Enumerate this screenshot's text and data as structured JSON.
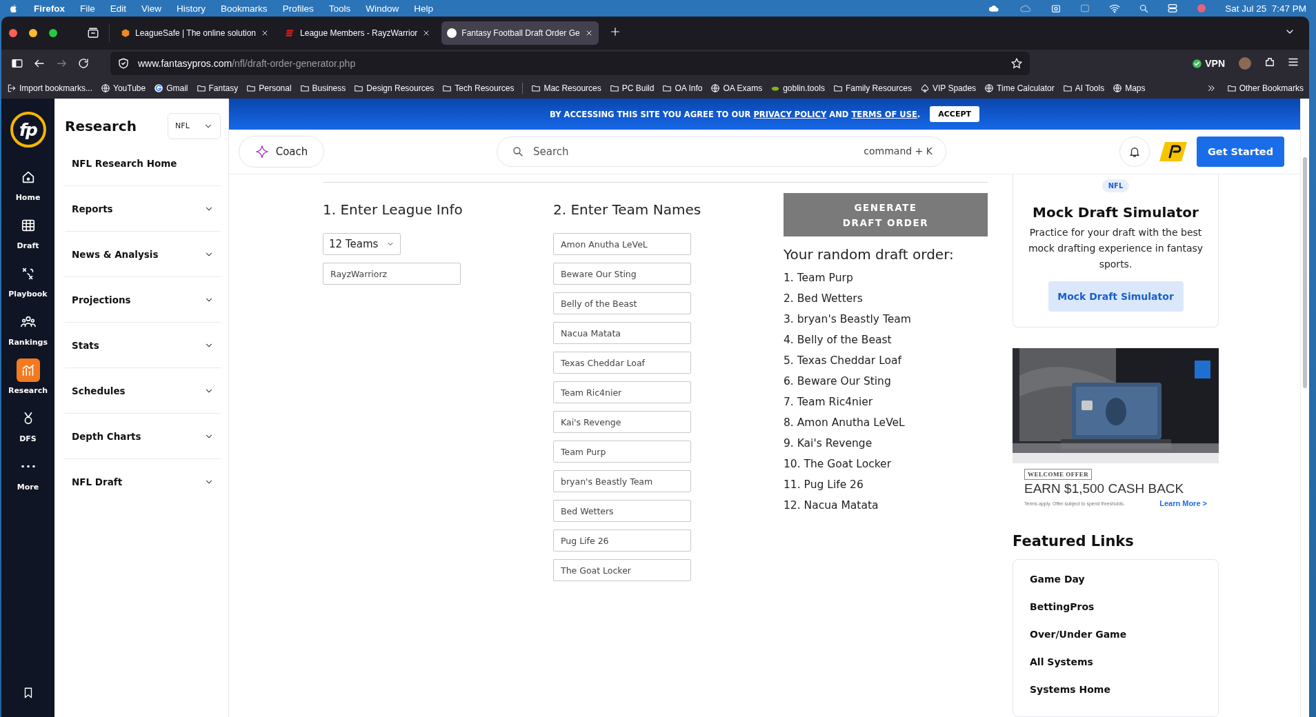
{
  "menu_bar": {
    "app": "Firefox",
    "menus": [
      "File",
      "Edit",
      "View",
      "History",
      "Bookmarks",
      "Profiles",
      "Tools",
      "Window",
      "Help"
    ],
    "clock": "Sat Jul 25  7:47 PM"
  },
  "tabs": [
    {
      "title": "LeagueSafe | The online solution",
      "kind": "hexagon",
      "selected": false
    },
    {
      "title": "League Members - RayzWarrior",
      "kind": "stripes",
      "selected": false
    },
    {
      "title": "Fantasy Football Draft Order Ge",
      "kind": "badge",
      "selected": true
    }
  ],
  "address": {
    "domain": "www.fantasypros.com",
    "path": "/nfl/draft-order-generator.php"
  },
  "vpn": "VPN",
  "bookmarks": [
    {
      "label": "Import bookmarks...",
      "kind": "import"
    },
    {
      "label": "YouTube",
      "kind": "globe"
    },
    {
      "label": "Gmail",
      "kind": "google"
    },
    {
      "label": "Fantasy",
      "kind": "folder"
    },
    {
      "label": "Personal",
      "kind": "folder"
    },
    {
      "label": "Business",
      "kind": "folder"
    },
    {
      "label": "Design Resources",
      "kind": "folder"
    },
    {
      "label": "Tech Resources",
      "kind": "folder"
    },
    {
      "label": "Mac Resources",
      "kind": "folder"
    },
    {
      "label": "PC Build",
      "kind": "folder"
    },
    {
      "label": "OA Info",
      "kind": "folder"
    },
    {
      "label": "OA Exams",
      "kind": "globe"
    },
    {
      "label": "goblin.tools",
      "kind": "goblin"
    },
    {
      "label": "Family Resources",
      "kind": "folder"
    },
    {
      "label": "VIP Spades",
      "kind": "spade"
    },
    {
      "label": "Time Calculator",
      "kind": "globe"
    },
    {
      "label": "AI Tools",
      "kind": "folder"
    },
    {
      "label": "Maps",
      "kind": "globe"
    }
  ],
  "other_bookmarks": "Other Bookmarks",
  "logo": "fp",
  "rail": [
    {
      "label": "Home",
      "kind": "home",
      "selected": false
    },
    {
      "label": "Draft",
      "kind": "grid",
      "selected": false
    },
    {
      "label": "Playbook",
      "kind": "plays",
      "selected": false
    },
    {
      "label": "Rankings",
      "kind": "people",
      "selected": false
    },
    {
      "label": "Research",
      "kind": "chart",
      "selected": true
    },
    {
      "label": "DFS",
      "kind": "medal",
      "selected": false
    },
    {
      "label": "More",
      "kind": "dots",
      "selected": false
    }
  ],
  "sidebar": {
    "title": "Research",
    "sport": "NFL",
    "items": [
      {
        "label": "NFL Research Home",
        "kind": "link"
      },
      {
        "label": "Reports",
        "kind": "group"
      },
      {
        "label": "News & Analysis",
        "kind": "group"
      },
      {
        "label": "Projections",
        "kind": "group"
      },
      {
        "label": "Stats",
        "kind": "group"
      },
      {
        "label": "Schedules",
        "kind": "group"
      },
      {
        "label": "Depth Charts",
        "kind": "group"
      },
      {
        "label": "NFL Draft",
        "kind": "group"
      }
    ]
  },
  "banner": {
    "segments": [
      {
        "text": "BY ACCESSING THIS SITE YOU AGREE TO OUR",
        "kind": "text"
      },
      {
        "text": "PRIVACY POLICY",
        "kind": "link"
      },
      {
        "text": "AND",
        "kind": "text"
      },
      {
        "text": "TERMS OF USE",
        "kind": "link"
      }
    ],
    "end": ".",
    "button": "ACCEPT"
  },
  "header": {
    "coach": "Coach",
    "search": {
      "placeholder": "Search"
    },
    "shortcut": "command + K",
    "cta": "Get Started"
  },
  "league": {
    "heading": "1. Enter League Info",
    "teams": "12 Teams",
    "name": "RayzWarriorz"
  },
  "team_names": {
    "heading": "2. Enter Team Names",
    "names": [
      "Amon Anutha LeVeL",
      "Beware Our Sting",
      "Belly of the Beast",
      "Nacua Matata",
      "Texas Cheddar Loaf",
      "Team Ric4nier",
      "Kai's Revenge",
      "Team Purp",
      "bryan's Beastly Team",
      "Bed Wetters",
      "Pug Life 26",
      "The Goat Locker"
    ]
  },
  "result": {
    "button": "GENERATE DRAFT ORDER",
    "heading": "Your random draft order:",
    "order": [
      "1. Team Purp",
      "2. Bed Wetters",
      "3. bryan's Beastly Team",
      "4. Belly of the Beast",
      "5. Texas Cheddar Loaf",
      "6. Beware Our Sting",
      "7. Team Ric4nier",
      "8. Amon Anutha LeVeL",
      "9. Kai's Revenge",
      "10. The Goat Locker",
      "11. Pug Life 26",
      "12. Nacua Matata"
    ]
  },
  "promo": {
    "badge": "NFL",
    "title": "Mock Draft Simulator",
    "text": "Practice for your draft with the best mock drafting experience in fantasy sports.",
    "button": "Mock Draft Simulator"
  },
  "ad": {
    "kind": "picture",
    "tag": "WELCOME OFFER",
    "headline": "EARN $1,500 CASH BACK",
    "fine_print": "Terms apply. Offer subject to spend thresholds.",
    "link": "Learn More >"
  },
  "featured": {
    "title": "Featured Links",
    "links": [
      "Game Day",
      "BettingPros",
      "Over/Under Game",
      "All Systems",
      "Systems Home"
    ]
  }
}
